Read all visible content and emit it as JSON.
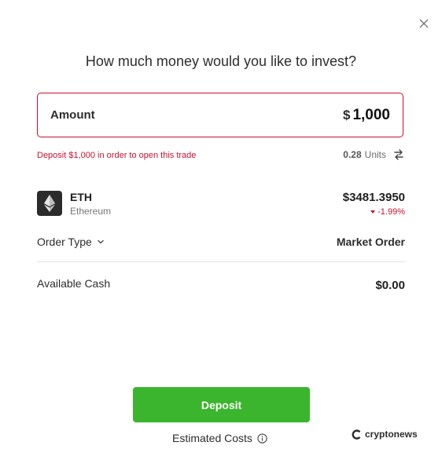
{
  "dialog": {
    "title": "How much money would you like to invest?"
  },
  "amount": {
    "label": "Amount",
    "currency": "$",
    "value": "1,000"
  },
  "validation": {
    "message": "Deposit $1,000 in order to open this trade"
  },
  "units": {
    "value": "0.28",
    "label": "Units"
  },
  "asset": {
    "symbol": "ETH",
    "name": "Ethereum",
    "price": "$3481.3950",
    "change": "-1.99%"
  },
  "order": {
    "label": "Order Type",
    "value": "Market Order"
  },
  "cash": {
    "label": "Available Cash",
    "value": "$0.00"
  },
  "actions": {
    "deposit_label": "Deposit",
    "estimated_costs_label": "Estimated Costs"
  },
  "watermark": {
    "text": "cryptonews"
  },
  "icons": {
    "close": "close-icon",
    "swap": "swap-icon",
    "asset": "ethereum-icon",
    "chevron": "chevron-down-icon",
    "info": "info-icon",
    "brand": "cryptonews-logo-icon"
  },
  "colors": {
    "accent_red": "#c8102e",
    "deposit_green": "#3bb52e"
  }
}
